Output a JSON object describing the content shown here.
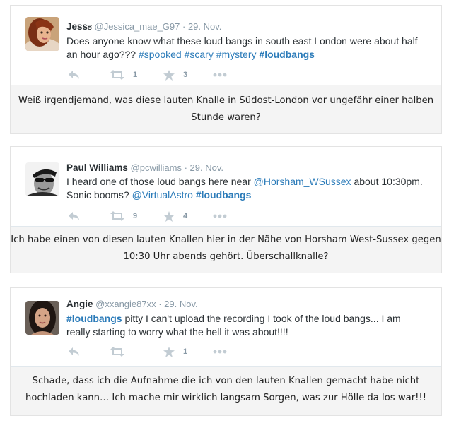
{
  "posts": [
    {
      "name": "Jess",
      "name_mark": "ಠ",
      "handle": "@Jessica_mae_G97",
      "sep": "·",
      "date": "29. Nov.",
      "text_segments": [
        {
          "t": "Does anyone know what these loud bangs in south east London were about half an hour ago??? "
        },
        {
          "t": "#spooked",
          "tag": true
        },
        {
          "t": " "
        },
        {
          "t": "#scary",
          "tag": true
        },
        {
          "t": " "
        },
        {
          "t": "#mystery",
          "tag": true
        },
        {
          "t": " "
        },
        {
          "t": "#loudbangs",
          "tag": true,
          "bold": true
        }
      ],
      "retweets": "1",
      "likes": "3",
      "translation": "Weiß irgendjemand, was diese lauten Knalle in Südost-London vor ungefähr einer halben Stunde waren?"
    },
    {
      "name": "Paul Williams",
      "handle": "@pcwilliams",
      "sep": "·",
      "date": "29. Nov.",
      "text_segments": [
        {
          "t": "I heard one of those loud bangs here near "
        },
        {
          "t": "@Horsham_WSussex",
          "tag": true
        },
        {
          "t": " about 10:30pm. Sonic booms? "
        },
        {
          "t": "@VirtualAstro",
          "tag": true
        },
        {
          "t": " "
        },
        {
          "t": "#loudbangs",
          "tag": true,
          "bold": true
        }
      ],
      "retweets": "9",
      "likes": "4",
      "translation": "Ich habe einen von diesen lauten Knallen hier in der Nähe von Horsham West-Sussex gegen 10:30 Uhr abends gehört. Überschallknalle?"
    },
    {
      "name": "Angie",
      "handle": "@xxangie87xx",
      "sep": "·",
      "date": "29. Nov.",
      "text_segments": [
        {
          "t": "#loudbangs",
          "tag": true,
          "bold": true
        },
        {
          "t": " pitty I can't upload the recording I took of the loud bangs... I am really starting to worry what the hell it was about!!!!"
        }
      ],
      "retweets": "",
      "likes": "1",
      "translation": "Schade, dass ich die Aufnahme die ich von den lauten Knallen gemacht habe nicht hochladen kann… Ich mache mir wirklich langsam Sorgen, was zur Hölle da los war!!!"
    }
  ],
  "icons": {
    "reply": "reply-icon",
    "retweet": "retweet-icon",
    "like": "star-icon",
    "more": "more-dots-icon"
  },
  "colors": {
    "link": "#2b7bb9",
    "meta": "#8899a6",
    "icon": "#aab8c2",
    "card_bg": "#f4f4f4",
    "text": "#292f33"
  }
}
